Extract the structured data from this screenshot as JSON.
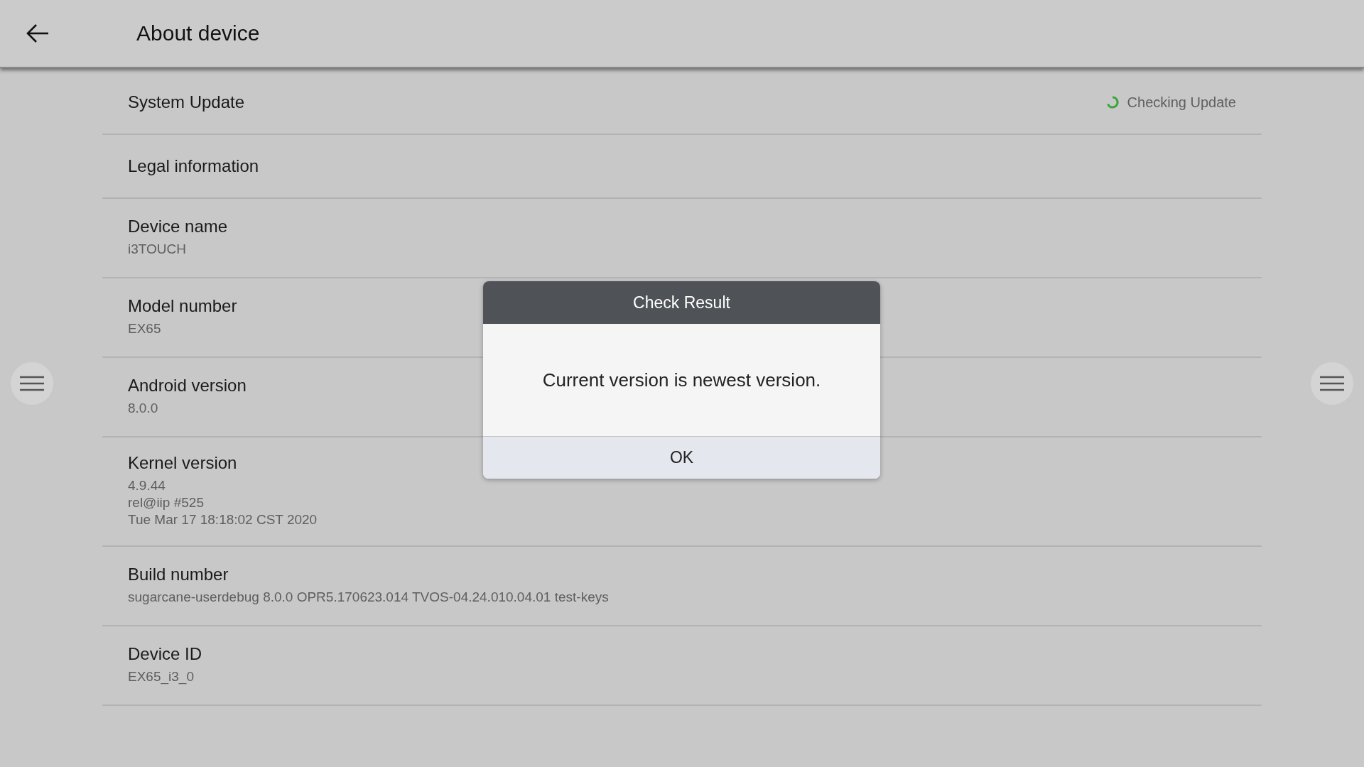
{
  "header": {
    "title": "About device"
  },
  "rows": [
    {
      "title": "System Update",
      "status": "Checking Update",
      "lines": []
    },
    {
      "title": "Legal information",
      "lines": []
    },
    {
      "title": "Device name",
      "lines": [
        "i3TOUCH"
      ]
    },
    {
      "title": "Model number",
      "lines": [
        "EX65"
      ]
    },
    {
      "title": "Android version",
      "lines": [
        "8.0.0"
      ]
    },
    {
      "title": "Kernel version",
      "lines": [
        "4.9.44",
        "rel@iip #525",
        "Tue Mar 17 18:18:02 CST 2020"
      ]
    },
    {
      "title": "Build number",
      "lines": [
        "sugarcane-userdebug 8.0.0 OPR5.170623.014 TVOS-04.24.010.04.01 test-keys"
      ]
    },
    {
      "title": "Device ID",
      "lines": [
        "EX65_i3_0"
      ]
    }
  ],
  "dialog": {
    "title": "Check Result",
    "message": "Current version is newest version.",
    "button": "OK"
  }
}
